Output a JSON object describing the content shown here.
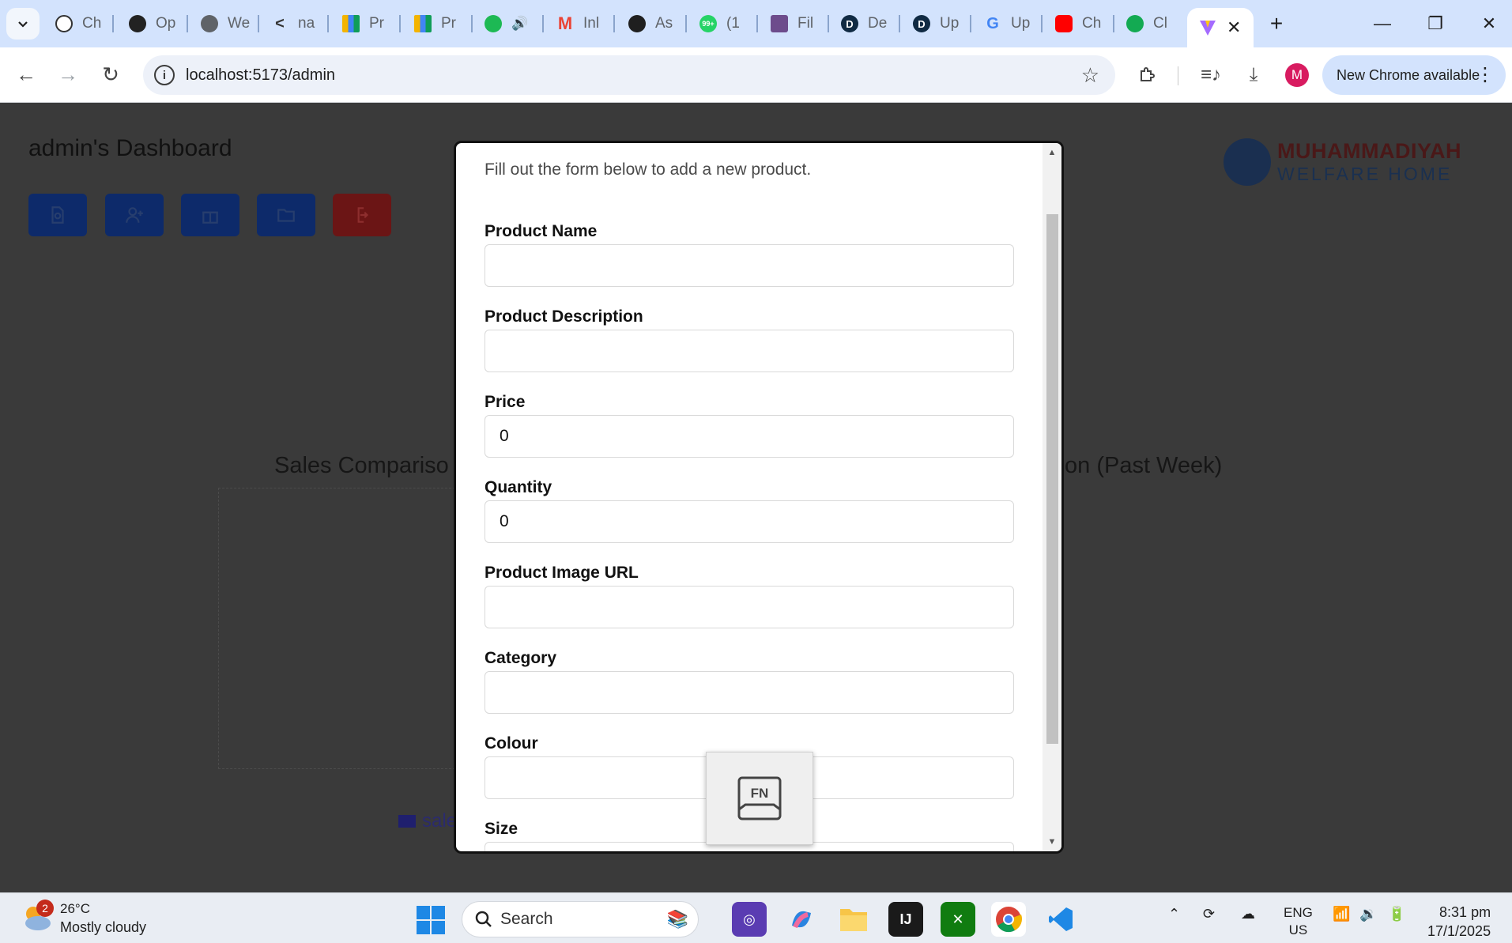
{
  "browser": {
    "tabs": [
      {
        "label": "Ch",
        "icon": "openai-icon"
      },
      {
        "label": "Op",
        "icon": "openai-dark-icon"
      },
      {
        "label": "We",
        "icon": "globe-icon"
      },
      {
        "label": "na",
        "icon": "prompt-icon"
      },
      {
        "label": "Pr",
        "icon": "bar-chart-icon"
      },
      {
        "label": "Pr",
        "icon": "bar-chart-icon"
      },
      {
        "label": "",
        "icon": "spotify-icon"
      },
      {
        "label": "Inl",
        "icon": "gmail-icon"
      },
      {
        "label": "As",
        "icon": "openai-circle-icon"
      },
      {
        "label": "(1",
        "icon": "whatsapp-icon"
      },
      {
        "label": "Fil",
        "icon": "university-icon"
      },
      {
        "label": "De",
        "icon": "d-icon"
      },
      {
        "label": "Up",
        "icon": "d-icon"
      },
      {
        "label": "Up",
        "icon": "google-icon"
      },
      {
        "label": "Ch",
        "icon": "youtube-icon"
      },
      {
        "label": "Cl",
        "icon": "mongodb-icon"
      }
    ],
    "url": "localhost:5173/admin",
    "update_label": "New Chrome available",
    "avatar_letter": "M"
  },
  "dashboard": {
    "title": "admin's Dashboard",
    "logo_line1": "MUHAMMADIYAH",
    "logo_line2": "WELFARE HOME",
    "chart_left_title": "Sales Compariso",
    "chart_right_title": "on (Past Week)",
    "legend_label": "sale",
    "accent_color": "#0d2a6a",
    "danger_color": "#6b1515"
  },
  "modal": {
    "description": "Fill out the form below to add a new product.",
    "fields": {
      "name": {
        "label": "Product Name",
        "value": ""
      },
      "description": {
        "label": "Product Description",
        "value": ""
      },
      "price": {
        "label": "Price",
        "value": "0"
      },
      "quantity": {
        "label": "Quantity",
        "value": "0"
      },
      "image_url": {
        "label": "Product Image URL",
        "value": ""
      },
      "category": {
        "label": "Category",
        "value": ""
      },
      "colour": {
        "label": "Colour",
        "value": ""
      },
      "size": {
        "label": "Size",
        "value": ""
      }
    }
  },
  "fn_overlay": {
    "label": "FN"
  },
  "taskbar": {
    "weather_badge": "2",
    "temperature": "26°C",
    "condition": "Mostly cloudy",
    "search_label": "Search",
    "lang_line1": "ENG",
    "lang_line2": "US",
    "time": "8:31 pm",
    "date": "17/1/2025"
  }
}
